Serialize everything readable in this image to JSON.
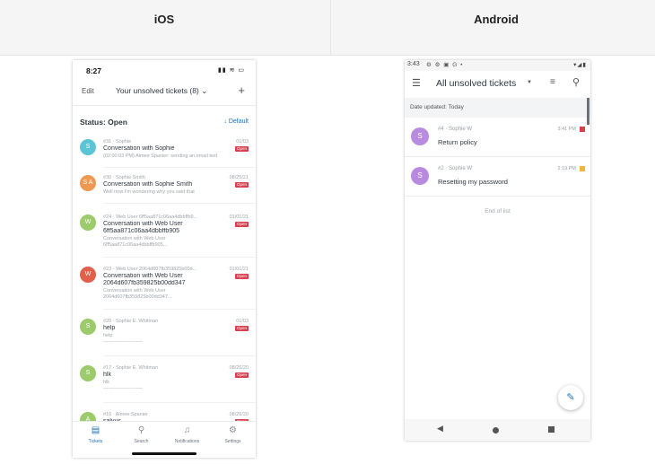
{
  "header": {
    "ios_label": "iOS",
    "android_label": "Android"
  },
  "ios": {
    "time": "8:27",
    "status_icons": "▮▮ ≋ ▭",
    "nav": {
      "edit": "Edit",
      "title": "Your unsolved tickets (8) ⌄",
      "plus": "+"
    },
    "status_label": "Status: Open",
    "sort_label": "↓ Default",
    "items": [
      {
        "initials": "S",
        "meta": "#31 · Sophie",
        "date": "01/03",
        "badge": "Open",
        "subject": "Conversation with Sophie",
        "preview": "(02:00:03 PM) Aimee Spanier: sending an email test"
      },
      {
        "initials": "S A",
        "meta": "#30 · Sophie Smith",
        "date": "08/25/21",
        "badge": "Open",
        "subject": "Conversation with Sophie Smith",
        "preview": "Well now I'm wondering why you said that"
      },
      {
        "initials": "W",
        "meta": "#24 · Web User 6ff5aa871c06aa4dbbffb9...",
        "date": "01/01/21",
        "badge": "Open",
        "subject": "Conversation with Web User",
        "subject2": "6ff5aa871c06aa4dbbffb905",
        "preview": "Conversation with Web User",
        "preview2": "6ff5aa871c06aa4dbbffb905..."
      },
      {
        "initials": "W",
        "meta": "#23 · Web User 2064d607fb359825b00d...",
        "date": "01/01/21",
        "badge": "Open",
        "subject": "Conversation with Web User",
        "subject2": "2064d607fb359825b00dd347",
        "preview": "Conversation with Web User",
        "preview2": "2064d607fb359825b00dd347..."
      },
      {
        "initials": "S",
        "meta": "#20 · Sophie E. Whitman",
        "date": "01/03",
        "badge": "Open",
        "subject": "help",
        "preview": "help",
        "preview2": "------------------------"
      },
      {
        "initials": "S",
        "meta": "#17 · Sophie E. Whitman",
        "date": "08/26/20",
        "badge": "Open",
        "subject": "hlk",
        "preview": "hlk",
        "preview2": "------------------------"
      },
      {
        "initials": "A",
        "meta": "#16 · Aimee Spanier",
        "date": "08/26/20",
        "badge": "Open",
        "subject": "salvus",
        "preview": ""
      }
    ],
    "tabs": [
      {
        "icon": "▤",
        "label": "Tickets"
      },
      {
        "icon": "⚲",
        "label": "Search"
      },
      {
        "icon": "♫",
        "label": "Notifications"
      },
      {
        "icon": "⚙",
        "label": "Settings"
      }
    ]
  },
  "android": {
    "time": "3:43",
    "status_icons": "⚙ ⚙ ▣ G •",
    "status_right": "▾◢▮",
    "appbar": {
      "menu": "☰",
      "title": "All unsolved tickets",
      "caret": "▼",
      "filter": "≡",
      "search": "⚲"
    },
    "date_band": "Date updated: Today",
    "items": [
      {
        "initials": "S",
        "meta": "#4 · Sophie W",
        "subject": "Return policy",
        "time": "3:41 PM"
      },
      {
        "initials": "S",
        "meta": "#2 · Sophie W",
        "subject": "Resetting my password",
        "time": "2:19 PM"
      }
    ],
    "end_of_list": "End of list",
    "fab_icon": "✎",
    "nav": {
      "back": "◀"
    }
  }
}
